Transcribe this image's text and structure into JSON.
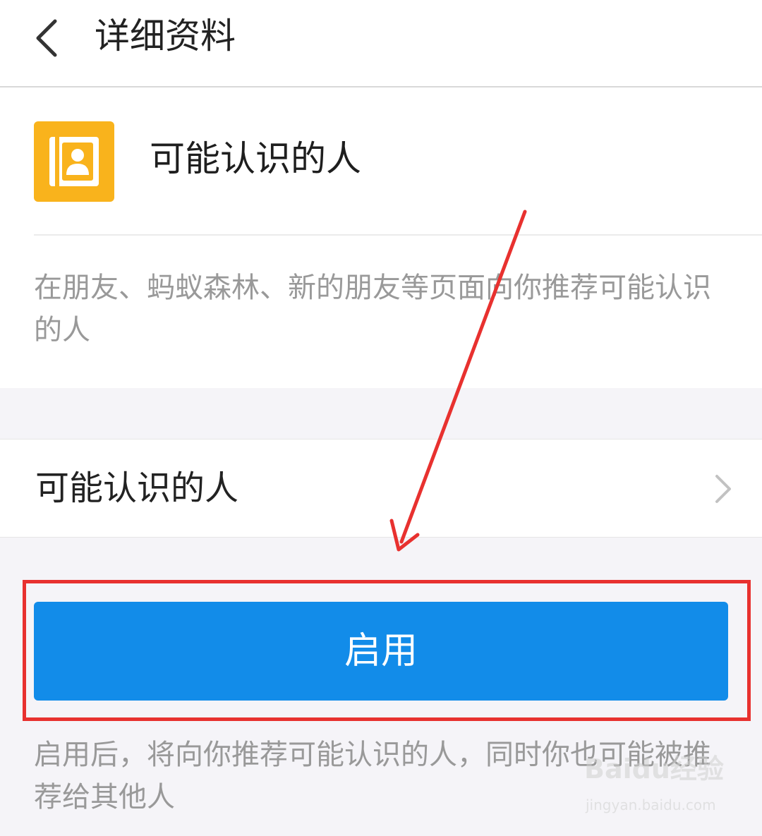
{
  "header": {
    "title": "详细资料"
  },
  "app": {
    "icon": "contacts-book-icon",
    "name": "可能认识的人",
    "description": "在朋友、蚂蚁森林、新的朋友等页面向你推荐可能认识的人"
  },
  "settings_row": {
    "label": "可能认识的人"
  },
  "enable_button": {
    "label": "启用"
  },
  "footer_note": "启用后，将向你推荐可能认识的人，同时你也可能被推荐给其他人",
  "watermark": {
    "brand": "Baidu经验",
    "url": "jingyan.baidu.com"
  },
  "colors": {
    "accent": "#128ce9",
    "icon_bg": "#f9b31c",
    "annotation": "#e8312f"
  }
}
